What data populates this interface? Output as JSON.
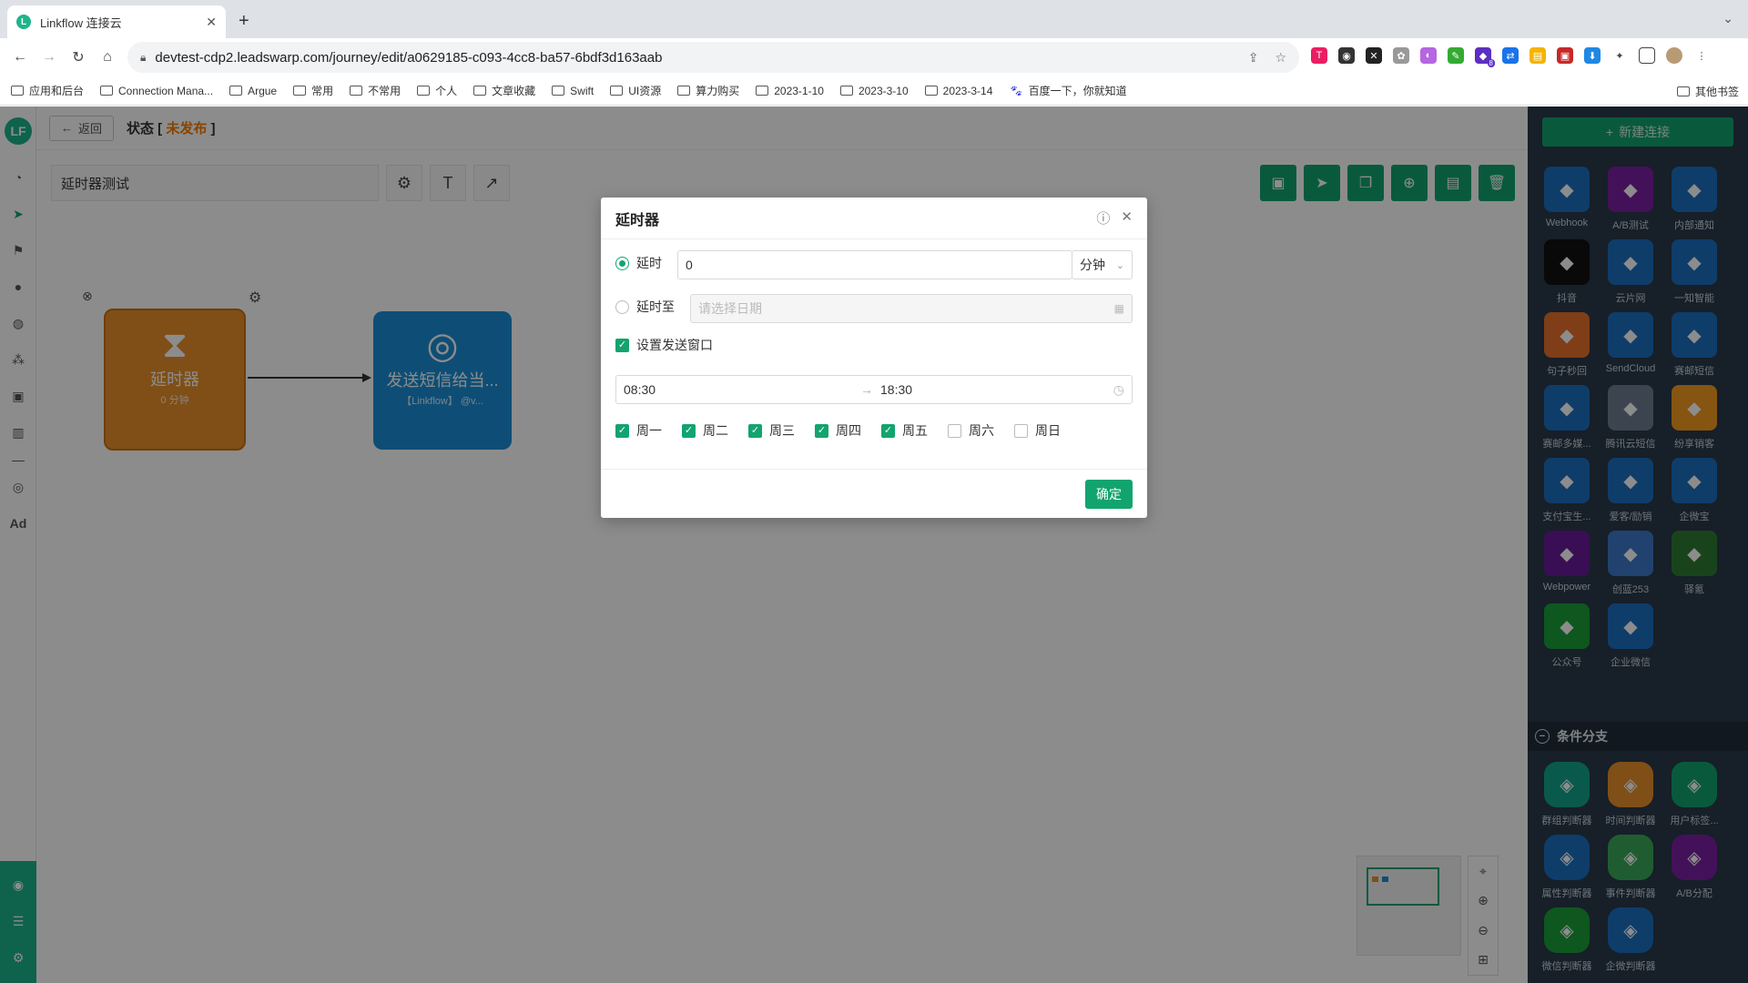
{
  "browser": {
    "tab_title": "Linkflow 连接云",
    "favicon_letter": "L",
    "url": "devtest-cdp2.leadswarp.com/journey/edit/a0629185-c093-4cc8-ba57-6bdf3d163aab",
    "ext_badge": "8",
    "bookmarks": [
      "应用和后台",
      "Connection Mana...",
      "Argue",
      "常用",
      "不常用",
      "个人",
      "文章收藏",
      "Swift",
      "UI资源",
      "算力购买",
      "2023-1-10",
      "2023-3-10",
      "2023-3-14"
    ],
    "bookmark_baidu": "百度一下，你就知道",
    "other_bookmarks": "其他书签"
  },
  "app": {
    "logo_letter": "LF",
    "nav_ad": "Ad",
    "back_label": "返回",
    "status_prefix": "状态 [",
    "status_value": "未发布",
    "status_suffix": "]",
    "journey_name": "延时器测试",
    "nodes": {
      "delay_title": "延时器",
      "delay_sub": "0 分钟",
      "sms_title": "发送短信给当...",
      "sms_sub": "【Linkflow】 @v..."
    }
  },
  "right_panel": {
    "new_connection": "新建连接",
    "apps": [
      {
        "label": "Webhook",
        "color": "#1b6fc2"
      },
      {
        "label": "A/B测试",
        "color": "#7a1fa2"
      },
      {
        "label": "内部通知",
        "color": "#1b6fc2"
      },
      {
        "label": "抖音",
        "color": "#111111"
      },
      {
        "label": "云片网",
        "color": "#1b6fc2"
      },
      {
        "label": "一知智能",
        "color": "#1b6fc2"
      },
      {
        "label": "句子秒回",
        "color": "#e8712a"
      },
      {
        "label": "SendCloud",
        "color": "#1b6fc2"
      },
      {
        "label": "赛邮短信",
        "color": "#1b6fc2"
      },
      {
        "label": "赛邮多媒...",
        "color": "#1b6fc2"
      },
      {
        "label": "腾讯云短信",
        "color": "#6e7f90"
      },
      {
        "label": "纷享销客",
        "color": "#f39c1f"
      },
      {
        "label": "支付宝生...",
        "color": "#1b6fc2"
      },
      {
        "label": "爱客/励销",
        "color": "#1b6fc2"
      },
      {
        "label": "企微宝",
        "color": "#1b6fc2"
      },
      {
        "label": "Webpower",
        "color": "#6a1b9a"
      },
      {
        "label": "创蓝253",
        "color": "#3c78c8"
      },
      {
        "label": "驿氪",
        "color": "#2e7d32"
      },
      {
        "label": "公众号",
        "color": "#1b9e3a"
      },
      {
        "label": "企业微信",
        "color": "#1b6fc2"
      }
    ],
    "section_title": "条件分支",
    "branches": [
      {
        "label": "群组判断器",
        "color": "#12a48a"
      },
      {
        "label": "时间判断器",
        "color": "#e8912a"
      },
      {
        "label": "用户标签...",
        "color": "#12a46f"
      },
      {
        "label": "属性判断器",
        "color": "#1b6fc2"
      },
      {
        "label": "事件判断器",
        "color": "#3aaa5a"
      },
      {
        "label": "A/B分配",
        "color": "#7a1fa2"
      },
      {
        "label": "微信判断器",
        "color": "#1b9e3a"
      },
      {
        "label": "企微判断器",
        "color": "#1b6fc2"
      }
    ]
  },
  "modal": {
    "title": "延时器",
    "delay_label": "延时",
    "delay_value": "0",
    "unit": "分钟",
    "delay_until_label": "延时至",
    "date_placeholder": "请选择日期",
    "send_window_label": "设置发送窗口",
    "time_start": "08:30",
    "time_end": "18:30",
    "days": [
      {
        "label": "周一",
        "checked": true
      },
      {
        "label": "周二",
        "checked": true
      },
      {
        "label": "周三",
        "checked": true
      },
      {
        "label": "周四",
        "checked": true
      },
      {
        "label": "周五",
        "checked": true
      },
      {
        "label": "周六",
        "checked": false
      },
      {
        "label": "周日",
        "checked": false
      }
    ],
    "confirm": "确定"
  },
  "colors": {
    "brand": "#1db58a",
    "button_green": "#12a46f",
    "delay_node": "#e8912a",
    "sms_node": "#1b8fd8",
    "status_warning": "#f57c00",
    "panel_bg": "#2a3a4a"
  }
}
